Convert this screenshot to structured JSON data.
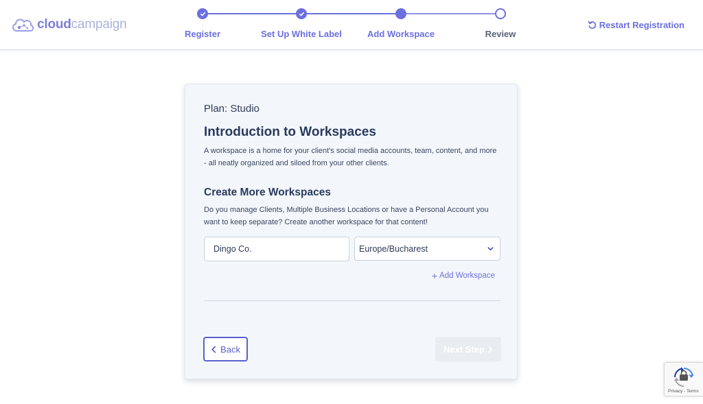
{
  "header": {
    "logo": {
      "word_bold": "cloud",
      "word_light": "campaign"
    },
    "steps": [
      {
        "label": "Register",
        "state": "done"
      },
      {
        "label": "Set Up White Label",
        "state": "done"
      },
      {
        "label": "Add Workspace",
        "state": "current"
      },
      {
        "label": "Review",
        "state": "future"
      }
    ],
    "restart_label": "Restart Registration"
  },
  "card": {
    "plan": "Plan: Studio",
    "intro_title": "Introduction to Workspaces",
    "intro_desc": "A workspace is a home for your client's social media accounts, team, content, and more - all neatly organized and siloed from your other clients.",
    "create_title": "Create More Workspaces",
    "create_desc": "Do you manage Clients, Multiple Business Locations or have a Personal Account you want to keep separate? Create another workspace for that content!",
    "workspace_name_value": "Dingo Co.",
    "timezone_value": "Europe/Bucharest",
    "add_workspace_label": "Add Workspace",
    "back_label": "Back",
    "next_label": "Next Step"
  },
  "recaptcha": {
    "links": "Privacy - Terms"
  },
  "colors": {
    "accent": "#6c6fe0",
    "heading": "#2a3a5e",
    "card_bg": "#f3f7fb"
  },
  "icons": [
    "cloud-logo-icon",
    "check-icon",
    "restart-icon",
    "chevron-down-icon",
    "plus-icon",
    "chevron-left-icon",
    "chevron-right-icon",
    "recaptcha-icon"
  ]
}
